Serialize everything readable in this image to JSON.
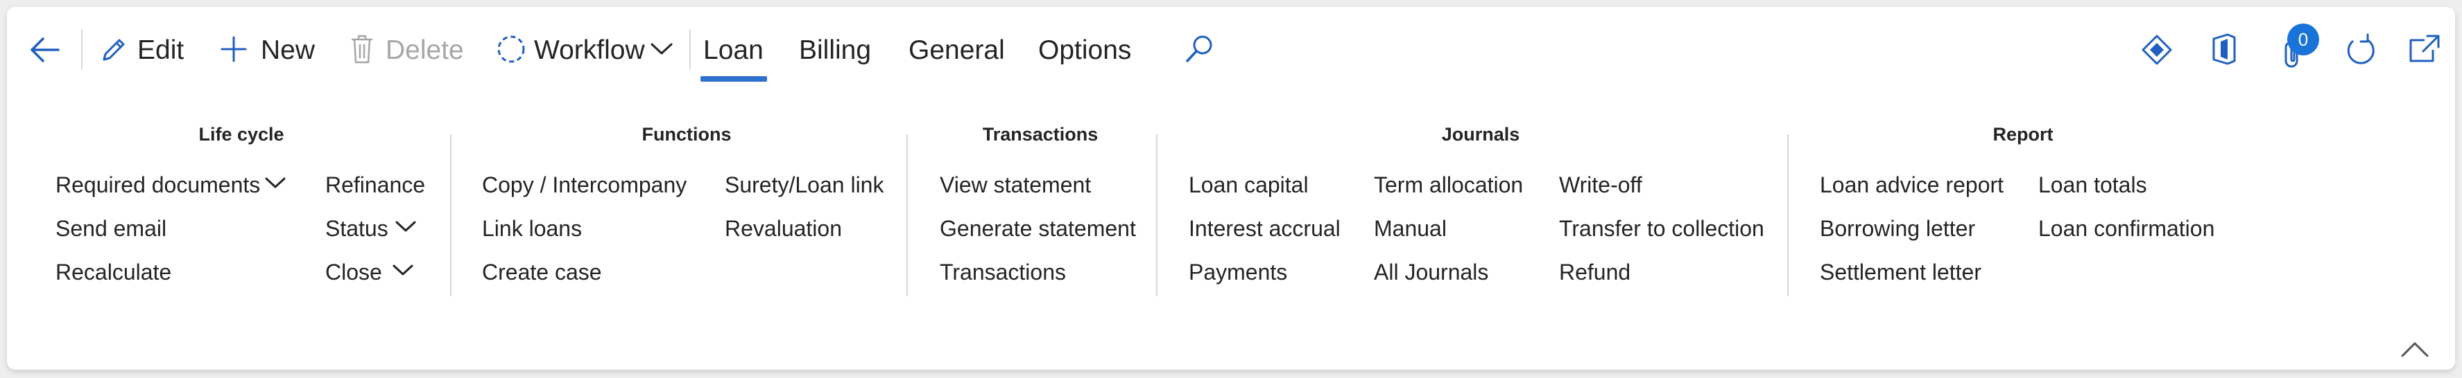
{
  "toolbar": {
    "back_icon": "back-arrow-icon",
    "edit": {
      "label": "Edit",
      "icon": "pencil-icon"
    },
    "new": {
      "label": "New",
      "icon": "plus-icon"
    },
    "delete": {
      "label": "Delete",
      "icon": "trash-icon",
      "disabled": true
    },
    "workflow": {
      "label": "Workflow",
      "icon": "workflow-icon",
      "dropdown_icon": "chevron-down-icon"
    },
    "tabs": [
      {
        "label": "Loan",
        "selected": true
      },
      {
        "label": "Billing",
        "selected": false
      },
      {
        "label": "General",
        "selected": false
      },
      {
        "label": "Options",
        "selected": false
      }
    ],
    "search_icon": "search-icon",
    "right_icons": [
      "diamond-icon",
      "office-icon",
      "attachment-icon",
      "refresh-icon",
      "open-new-window-icon"
    ],
    "attachment_count": "0"
  },
  "groups": {
    "lifecycle": {
      "title": "Life cycle",
      "items": [
        "Required documents",
        "Send email",
        "Recalculate",
        "Refinance",
        "Status",
        "Close"
      ]
    },
    "functions": {
      "title": "Functions",
      "items": [
        "Copy / Intercompany",
        "Link loans",
        "Create case",
        "Surety/Loan link",
        "Revaluation"
      ]
    },
    "transactions": {
      "title": "Transactions",
      "items": [
        "View statement",
        "Generate statement",
        "Transactions"
      ]
    },
    "journals": {
      "title": "Journals",
      "items": [
        "Loan capital",
        "Interest accrual",
        "Payments",
        "Term allocation",
        "Manual",
        "All Journals",
        "Write-off",
        "Transfer to collection",
        "Refund"
      ]
    },
    "report": {
      "title": "Report",
      "items": [
        "Loan advice report",
        "Borrowing letter",
        "Settlement letter",
        "Loan totals",
        "Loan confirmation"
      ]
    }
  },
  "collapse_icon": "chevron-up-icon",
  "colors": {
    "accent": "#2f6fd0",
    "icon_blue": "#1f5fbf",
    "badge": "#1a73d9",
    "disabled": "#a6a6a6"
  }
}
